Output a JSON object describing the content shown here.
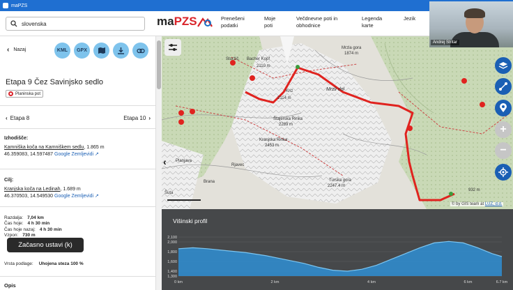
{
  "titlebar": {
    "title": "maPZS"
  },
  "search": {
    "value": "slovenska"
  },
  "brand": {
    "ma": "ma",
    "pzs": "PZS"
  },
  "nav": {
    "items": [
      "Prenešeni podatki",
      "Moje poti",
      "Večdnevne poti in obhodnice",
      "Legenda karte",
      "Jezik"
    ]
  },
  "webcam": {
    "name": "Andrej Stritar"
  },
  "sidebar": {
    "back_label": "Nazaj",
    "buttons": [
      "KML",
      "GPX"
    ],
    "stage_title": "Etapa 9 Čez Savinjsko sedlo",
    "tag": "Planinska pot",
    "prev": "Etapa 8",
    "next": "Etapa 10",
    "start": {
      "label": "Izhodišče:",
      "place": "Kamniška koča na Kamniškem sedlu",
      "alt": ", 1.865 m",
      "coords": "46.359083, 14.597487",
      "maps": "Google Zemljevidi"
    },
    "end": {
      "label": "Cilj:",
      "place": "Kranjska koča na Ledinah",
      "alt": ", 1.689 m",
      "coords": "46.370503, 14.549530",
      "maps": "Google Zemljevidi"
    },
    "stats": [
      {
        "k": "Razdalja:",
        "v": "7,04 km"
      },
      {
        "k": "Čas hoje:",
        "v": "4 h 30 min"
      },
      {
        "k": "Čas hoje nazaj:",
        "v": "4 h 30 min"
      },
      {
        "k": "Vzpon:",
        "v": "730 m"
      }
    ],
    "tooltip": "Začasno ustavi (k)",
    "surface_label": "Vrsta podlage:",
    "surface_value": "Uhojena steza 100 %",
    "opis": "Opis"
  },
  "map": {
    "labels": [
      "Storžič",
      "Bacher Kopf",
      "Mrzla gora",
      "Kriz",
      "Mrzli dol",
      "Štajerska Rinka",
      "Kranjska Rinka",
      "Turska gora",
      "Rjavec",
      "Brana",
      "Planjava",
      "Šuta"
    ],
    "label_values": [
      "2110 m",
      "2114 m",
      "1874 m",
      "2289 m",
      "2453 m",
      "2247.4 m",
      "1899 m",
      "2208 m",
      "1866 m",
      "932 m"
    ],
    "attribution_prefix": "© by GIS team at ",
    "attribution_link": "LUZ, d.d."
  },
  "profile": {
    "title": "Višinski profil",
    "yticks": [
      "2,100",
      "2,000",
      "1,800",
      "1,600",
      "1,400",
      "1,300"
    ],
    "xticks": [
      "0 km",
      "2 km",
      "4 km",
      "6 km",
      "6.7 km"
    ]
  },
  "chart_data": {
    "type": "area",
    "title": "Višinski profil",
    "xlabel": "",
    "ylabel": "",
    "x_unit": "km",
    "ylim": [
      1300,
      2100
    ],
    "xlim": [
      0,
      6.7
    ],
    "x": [
      0,
      0.3,
      0.6,
      1.0,
      1.4,
      1.8,
      2.2,
      2.6,
      2.9,
      3.2,
      3.5,
      3.8,
      4.1,
      4.4,
      4.7,
      5.0,
      5.3,
      5.6,
      5.9,
      6.2,
      6.5,
      6.7
    ],
    "y": [
      1860,
      1880,
      1860,
      1820,
      1780,
      1720,
      1640,
      1560,
      1480,
      1420,
      1400,
      1440,
      1520,
      1640,
      1760,
      1880,
      1980,
      2010,
      1980,
      1880,
      1760,
      1700
    ],
    "color": "#2f8fd3"
  }
}
